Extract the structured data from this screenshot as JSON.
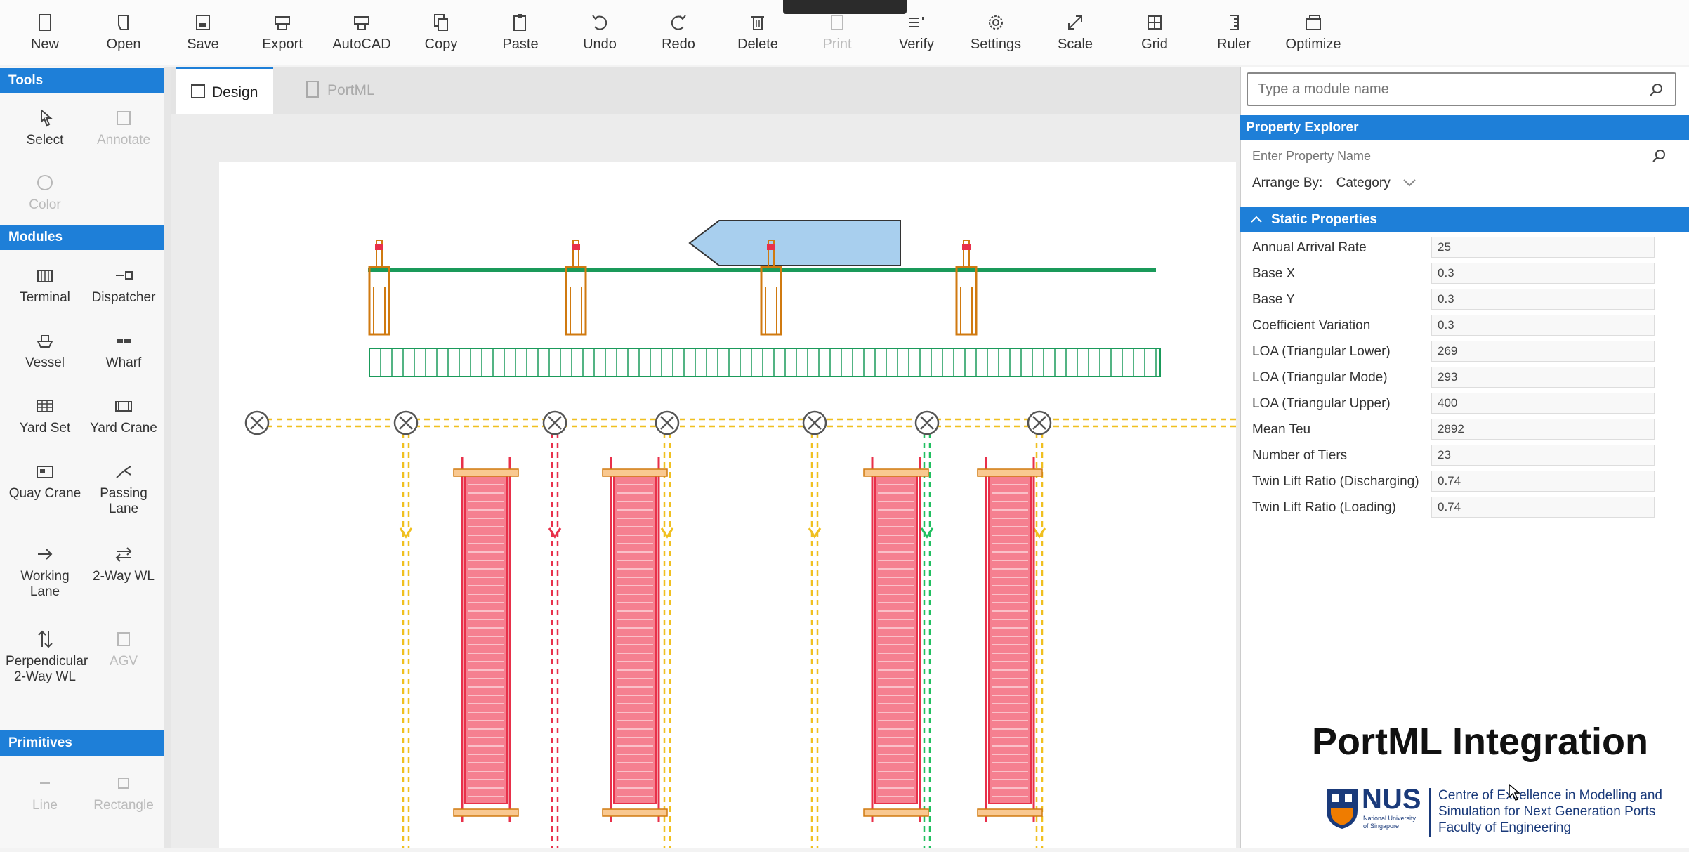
{
  "toolbar": {
    "buttons": [
      {
        "label": "New",
        "icon": "new-file-icon"
      },
      {
        "label": "Open",
        "icon": "open-folder-icon"
      },
      {
        "label": "Save",
        "icon": "save-icon"
      },
      {
        "label": "Export",
        "icon": "export-icon"
      },
      {
        "label": "AutoCAD",
        "icon": "autocad-icon"
      },
      {
        "label": "Copy",
        "icon": "copy-icon"
      },
      {
        "label": "Paste",
        "icon": "paste-icon"
      },
      {
        "label": "Undo",
        "icon": "undo-icon"
      },
      {
        "label": "Redo",
        "icon": "redo-icon"
      },
      {
        "label": "Delete",
        "icon": "delete-icon"
      },
      {
        "label": "Print",
        "icon": "print-icon"
      },
      {
        "label": "Verify",
        "icon": "verify-icon"
      },
      {
        "label": "Settings",
        "icon": "gear-icon"
      },
      {
        "label": "Scale",
        "icon": "scale-icon"
      },
      {
        "label": "Grid",
        "icon": "grid-icon"
      },
      {
        "label": "Ruler",
        "icon": "ruler-icon"
      },
      {
        "label": "Optimize",
        "icon": "optimize-icon"
      }
    ]
  },
  "left_panel": {
    "tools_title": "Tools",
    "tools": [
      "Select",
      "Annotate",
      "Color"
    ],
    "modules_title": "Modules",
    "modules": [
      "Terminal",
      "Dispatcher",
      "Vessel",
      "Wharf",
      "Yard Set",
      "Yard Crane",
      "Quay Crane",
      "Passing Lane",
      "Working Lane",
      "2-Way WL",
      "Perpendicular 2-Way WL",
      "AGV"
    ],
    "primitives_title": "Primitives",
    "primitives": [
      "Line",
      "Rectangle"
    ]
  },
  "tabs": [
    {
      "label": "Design",
      "icon": "design-grid-icon"
    },
    {
      "label": "PortML",
      "icon": "document-icon"
    }
  ],
  "right_panel": {
    "module_search_placeholder": "Type a module name",
    "property_explorer_title": "Property Explorer",
    "property_search_placeholder": "Enter Property Name",
    "arrange_by_label": "Arrange By:",
    "arrange_by_value": "Category",
    "static_properties_title": "Static Properties",
    "properties": [
      {
        "name": "Annual Arrival Rate",
        "value": "25"
      },
      {
        "name": "Base X",
        "value": "0.3"
      },
      {
        "name": "Base Y",
        "value": "0.3"
      },
      {
        "name": "Coefficient Variation",
        "value": "0.3"
      },
      {
        "name": "LOA (Triangular Lower)",
        "value": "269"
      },
      {
        "name": "LOA (Triangular Mode)",
        "value": "293"
      },
      {
        "name": "LOA (Triangular Upper)",
        "value": "400"
      },
      {
        "name": "Mean Teu",
        "value": "2892"
      },
      {
        "name": "Number of Tiers",
        "value": "23"
      },
      {
        "name": "Twin Lift Ratio (Discharging)",
        "value": "0.74"
      },
      {
        "name": "Twin Lift Ratio (Loading)",
        "value": "0.74"
      }
    ]
  },
  "branding": {
    "title": "PortML Integration",
    "logo_text": "NUS",
    "logo_sub1": "National University",
    "logo_sub2": "of Singapore",
    "line1": "Centre of Excellence in Modelling and",
    "line2": "Simulation for Next Generation Ports",
    "line3": "Faculty of Engineering"
  },
  "colors": {
    "accent": "#1e7fd8",
    "wharf": "#1a9a5a",
    "quay_crane": "#d07a10",
    "yard_block": "#e8304a",
    "lane_yellow": "#f0c020",
    "lane_green": "#20c060",
    "vessel": "#a8cfee",
    "nus_blue": "#1a3a7a",
    "nus_orange": "#ef7c00"
  }
}
